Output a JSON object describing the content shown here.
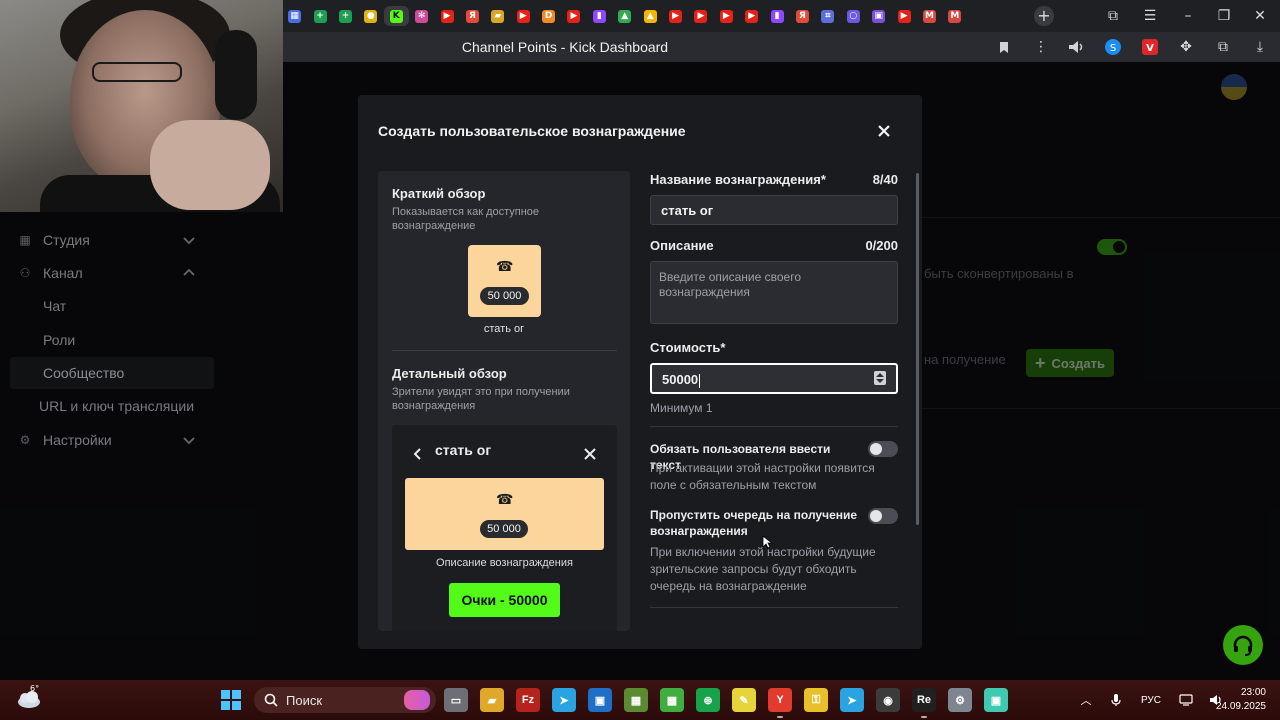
{
  "browser": {
    "page_title": "Channel Points - Kick Dashboard",
    "tab_favicons": [
      {
        "name": "tab-google-docs",
        "color": "#4a6ee0",
        "glyph": "▦"
      },
      {
        "name": "tab-sheets-1",
        "color": "#1e9e50",
        "glyph": "+"
      },
      {
        "name": "tab-sheets-2",
        "color": "#1e9e50",
        "glyph": "+"
      },
      {
        "name": "tab-circle-yellow",
        "color": "#e0b20f",
        "glyph": "●"
      },
      {
        "name": "tab-kick",
        "color": "#53fc18",
        "glyph": "K",
        "active": true
      },
      {
        "name": "tab-colorwheel",
        "color": "#d04a9a",
        "glyph": "✻"
      },
      {
        "name": "tab-youtube-1",
        "color": "#e62117",
        "glyph": "▶"
      },
      {
        "name": "tab-yandex-1",
        "color": "#e34a3a",
        "glyph": "Я"
      },
      {
        "name": "tab-folder",
        "color": "#d9a726",
        "glyph": "▰"
      },
      {
        "name": "tab-youtube-2",
        "color": "#e62117",
        "glyph": "▶"
      },
      {
        "name": "tab-donation",
        "color": "#f08a24",
        "glyph": "D"
      },
      {
        "name": "tab-youtube-3",
        "color": "#e62117",
        "glyph": "▶"
      },
      {
        "name": "tab-twitch-1",
        "color": "#9146ff",
        "glyph": "▮"
      },
      {
        "name": "tab-drive-1",
        "color": "#34a853",
        "glyph": "▲"
      },
      {
        "name": "tab-drive-2",
        "color": "#f4b400",
        "glyph": "▲"
      },
      {
        "name": "tab-youtube-4",
        "color": "#e62117",
        "glyph": "▶"
      },
      {
        "name": "tab-youtube-5",
        "color": "#e62117",
        "glyph": "▶"
      },
      {
        "name": "tab-youtube-6",
        "color": "#e62117",
        "glyph": "▶"
      },
      {
        "name": "tab-youtube-7",
        "color": "#e62117",
        "glyph": "▶"
      },
      {
        "name": "tab-twitch-2",
        "color": "#9146ff",
        "glyph": "▮"
      },
      {
        "name": "tab-yandex-2",
        "color": "#e34a3a",
        "glyph": "Я"
      },
      {
        "name": "tab-grid",
        "color": "#5d6ed8",
        "glyph": "⌗"
      },
      {
        "name": "tab-ring",
        "color": "#6a5ae0",
        "glyph": "○"
      },
      {
        "name": "tab-square",
        "color": "#7b4fd6",
        "glyph": "▣"
      },
      {
        "name": "tab-youtube-8",
        "color": "#e62117",
        "glyph": "▶"
      },
      {
        "name": "tab-gmail-1",
        "color": "#d64a3f",
        "glyph": "M"
      },
      {
        "name": "tab-gmail-2",
        "color": "#d64a3f",
        "glyph": "M"
      }
    ],
    "new_tab_glyph": "+"
  },
  "sidebar": {
    "items": [
      {
        "label": "Студия",
        "icon": "grid-icon",
        "glyph": "▦",
        "chevron": "down"
      },
      {
        "label": "Канал",
        "icon": "users-icon",
        "glyph": "⚇",
        "chevron": "up"
      },
      {
        "label": "Чат",
        "sub": true
      },
      {
        "label": "Роли",
        "sub": true
      },
      {
        "label": "Сообщество",
        "sub": true,
        "active": true
      },
      {
        "label": "URL и ключ трансляции",
        "sub": true
      },
      {
        "label": "Настройки",
        "icon": "gear-icon",
        "glyph": "⚙",
        "chevron": "down"
      }
    ]
  },
  "background": {
    "note": "быть сконвертированы в",
    "receive_label": "на получение",
    "create_label": "Создать",
    "create_icon_glyph": "+"
  },
  "modal": {
    "title": "Создать пользовательское вознаграждение",
    "preview": {
      "short_heading": "Краткий обзор",
      "short_sub": "Показывается как доступное вознаграждение",
      "card_price": "50 000",
      "card_name": "стать ог",
      "detail_heading": "Детальный обзор",
      "detail_sub": "Зрители увидят это при получении вознаграждения",
      "detail_title": "стать ог",
      "detail_price": "50 000",
      "detail_description": "Описание вознаграждения",
      "redeem_label": "Очки - 50000"
    },
    "form": {
      "name_label": "Название вознаграждения*",
      "name_counter": "8/40",
      "name_value": "стать ог",
      "desc_label": "Описание",
      "desc_counter": "0/200",
      "desc_placeholder": "Введите описание своего вознаграждения",
      "cost_label": "Стоимость*",
      "cost_value": "50000",
      "cost_min": "Минимум 1",
      "require_text_title": "Обязать пользователя ввести текст",
      "require_text_desc": "При активации этой настройки появится поле с обязательным текстом",
      "require_text_on": false,
      "skip_queue_title": "Пропустить очередь на получение вознаграждения",
      "skip_queue_desc": "При включении этой настройки будущие зрительские запросы будут обходить очередь на вознаграждение",
      "skip_queue_on": false
    },
    "colors": {
      "accent": "#53fc18",
      "card": "#fcd59d"
    }
  },
  "taskbar": {
    "weather_temp": "6°",
    "search_placeholder": "Поиск",
    "apps": [
      {
        "name": "taskbar-file-explorer-gray",
        "color": "#6d6f74",
        "glyph": "▭"
      },
      {
        "name": "taskbar-file-explorer",
        "color": "#e0a82a",
        "glyph": "▰"
      },
      {
        "name": "taskbar-filezilla",
        "color": "#b5231b",
        "glyph": "Fz"
      },
      {
        "name": "taskbar-telegram",
        "color": "#2aa3e0",
        "glyph": "➤"
      },
      {
        "name": "taskbar-photos",
        "color": "#1f6fc9",
        "glyph": "▣"
      },
      {
        "name": "taskbar-minecraft-1",
        "color": "#5b8a32",
        "glyph": "▦"
      },
      {
        "name": "taskbar-minecraft-2",
        "color": "#3fae3f",
        "glyph": "▩"
      },
      {
        "name": "taskbar-xbox",
        "color": "#17a34a",
        "glyph": "⊛"
      },
      {
        "name": "taskbar-notes",
        "color": "#e6d43a",
        "glyph": "✎"
      },
      {
        "name": "taskbar-yandex-browser",
        "color": "#e23b2e",
        "glyph": "Y",
        "running": true
      },
      {
        "name": "taskbar-security",
        "color": "#e8c02a",
        "glyph": "⚿"
      },
      {
        "name": "taskbar-telegram-2",
        "color": "#2aa3e0",
        "glyph": "➤"
      },
      {
        "name": "taskbar-obs",
        "color": "#3b3b3b",
        "glyph": "◉"
      },
      {
        "name": "taskbar-reaper",
        "color": "#202020",
        "glyph": "Re",
        "running": true
      },
      {
        "name": "taskbar-settings",
        "color": "#7d8590",
        "glyph": "⚙"
      },
      {
        "name": "taskbar-kick-app",
        "color": "#3ec9b0",
        "glyph": "▣"
      }
    ],
    "lang": "РУС",
    "time": "23:00",
    "date": "24.09.2025"
  }
}
